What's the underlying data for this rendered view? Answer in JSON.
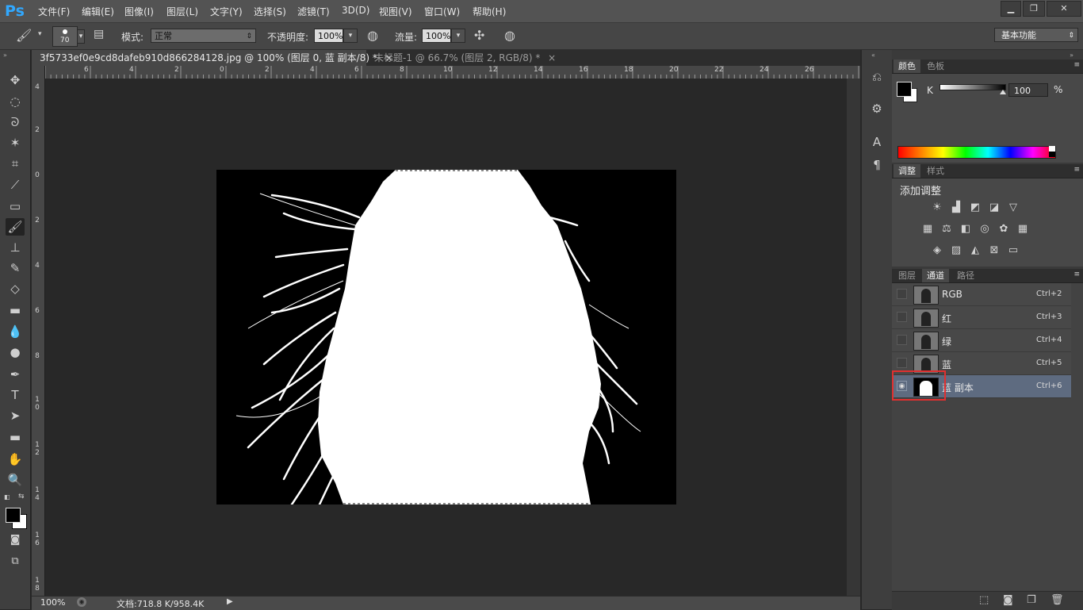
{
  "app": {
    "logo": "Ps"
  },
  "menu": [
    "文件(F)",
    "编辑(E)",
    "图像(I)",
    "图层(L)",
    "文字(Y)",
    "选择(S)",
    "滤镜(T)",
    "3D(D)",
    "视图(V)",
    "窗口(W)",
    "帮助(H)"
  ],
  "window_controls": {
    "minimize": "▁",
    "restore": "❐",
    "close": "✕"
  },
  "options": {
    "brush_size": "70",
    "mode_label": "模式:",
    "mode_value": "正常",
    "opacity_label": "不透明度:",
    "opacity_value": "100%",
    "flow_label": "流量:",
    "flow_value": "100%",
    "workspace": "基本功能"
  },
  "tabs": [
    {
      "title": "3f5733ef0e9cd8dafeb910d866284128.jpg @ 100% (图层 0, 蓝 副本/8) *",
      "close": "×"
    },
    {
      "title": "未标题-1 @ 66.7% (图层 2, RGB/8) *",
      "close": "×"
    }
  ],
  "ruler_top_ticks": [
    "6",
    "4",
    "2",
    "0",
    "2",
    "4",
    "6",
    "8",
    "10",
    "12",
    "14",
    "16",
    "18",
    "20",
    "22",
    "24",
    "26"
  ],
  "ruler_left_ticks": [
    "4",
    "2",
    "0",
    "2",
    "4",
    "6",
    "8",
    "1 0",
    "1 2",
    "1 4",
    "1 6",
    "1 8"
  ],
  "status": {
    "zoom": "100%",
    "doc": "文档:718.8 K/958.4K"
  },
  "panels": {
    "color": {
      "tabs": [
        "颜色",
        "色板"
      ],
      "k_label": "K",
      "k_value": "100",
      "k_unit": "%"
    },
    "adjustments": {
      "tabs": [
        "调整",
        "样式"
      ],
      "title": "添加调整"
    },
    "channels": {
      "tabs": [
        "图层",
        "通道",
        "路径"
      ],
      "rows": [
        {
          "name": "RGB",
          "shortcut": "Ctrl+2"
        },
        {
          "name": "红",
          "shortcut": "Ctrl+3"
        },
        {
          "name": "绿",
          "shortcut": "Ctrl+4"
        },
        {
          "name": "蓝",
          "shortcut": "Ctrl+5"
        },
        {
          "name": "蓝 副本",
          "shortcut": "Ctrl+6"
        }
      ],
      "selected_row": "蓝 副本",
      "highlight_color": "#e03030"
    }
  },
  "colors": {
    "accent": "#31a8ff",
    "selected_row": "#5e6b80"
  }
}
